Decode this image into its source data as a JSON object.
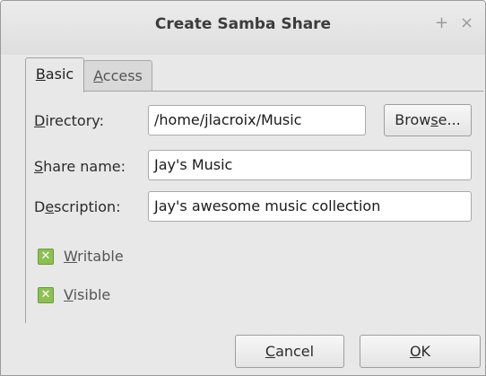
{
  "window": {
    "title": "Create Samba Share",
    "plus_glyph": "+",
    "close_glyph": "×"
  },
  "tabs": [
    {
      "mnemonic": "B",
      "rest": "asic"
    },
    {
      "mnemonic": "A",
      "rest": "ccess"
    }
  ],
  "form": {
    "directory": {
      "mnemonic": "D",
      "rest": "irectory:",
      "value": "/home/jlacroix/Music"
    },
    "browse": {
      "before": "Brow",
      "mnemonic": "s",
      "after": "e..."
    },
    "share_name": {
      "mnemonic": "S",
      "rest": "hare name:",
      "value": "Jay's Music"
    },
    "description": {
      "before": "D",
      "mnemonic": "e",
      "after": "scription:",
      "value": "Jay's awesome music collection"
    }
  },
  "options": {
    "check_glyph": "✕",
    "writable": {
      "mnemonic": "W",
      "rest": "ritable",
      "checked": true
    },
    "visible": {
      "mnemonic": "V",
      "rest": "isible",
      "checked": true
    }
  },
  "buttons": {
    "cancel": {
      "mnemonic": "C",
      "rest": "ancel"
    },
    "ok": {
      "mnemonic": "O",
      "rest": "K"
    }
  }
}
